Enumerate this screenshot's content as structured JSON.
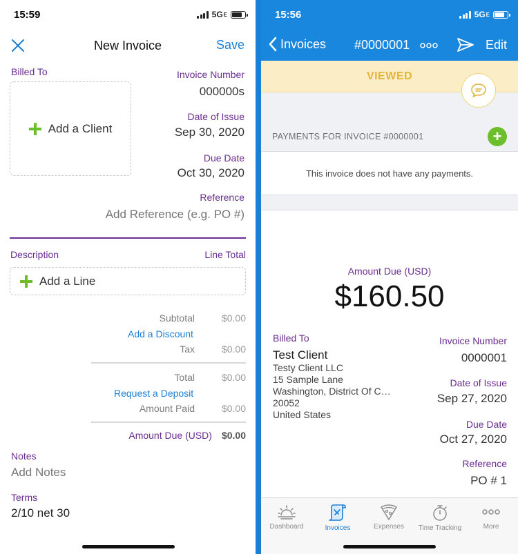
{
  "left": {
    "status": {
      "time": "15:59",
      "network": "5G",
      "network_suffix": "E"
    },
    "nav": {
      "title": "New Invoice",
      "save": "Save"
    },
    "billed_to": {
      "label": "Billed To",
      "add_client": "Add a Client"
    },
    "invoice_number": {
      "label": "Invoice Number",
      "value": "000000s"
    },
    "date_of_issue": {
      "label": "Date of Issue",
      "value": "Sep 30, 2020"
    },
    "due_date": {
      "label": "Due Date",
      "value": "Oct 30, 2020"
    },
    "reference": {
      "label": "Reference",
      "placeholder": "Add Reference (e.g. PO #)"
    },
    "lines": {
      "description_label": "Description",
      "line_total_label": "Line Total",
      "add_line": "Add a Line"
    },
    "totals": {
      "subtotal_label": "Subtotal",
      "subtotal_value": "$0.00",
      "add_discount": "Add a Discount",
      "tax_label": "Tax",
      "tax_value": "$0.00",
      "total_label": "Total",
      "total_value": "$0.00",
      "request_deposit": "Request a Deposit",
      "amount_paid_label": "Amount Paid",
      "amount_paid_value": "$0.00",
      "amount_due_label": "Amount Due (USD)",
      "amount_due_value": "$0.00"
    },
    "notes": {
      "label": "Notes",
      "placeholder": "Add Notes"
    },
    "terms": {
      "label": "Terms",
      "value": "2/10 net 30"
    }
  },
  "right": {
    "status": {
      "time": "15:56",
      "network": "5G",
      "network_suffix": "E"
    },
    "nav": {
      "back": "Invoices",
      "title": "#0000001",
      "edit": "Edit"
    },
    "viewed": "VIEWED",
    "payments_header": "PAYMENTS FOR INVOICE #0000001",
    "no_payments": "This invoice does not have any payments.",
    "amount_due": {
      "label": "Amount Due (USD)",
      "value": "$160.50"
    },
    "billed_to": {
      "label": "Billed To",
      "client_name": "Test Client",
      "address": [
        "Testy Client LLC",
        "15 Sample Lane",
        "Washington, District Of C…",
        "20052",
        "United States"
      ]
    },
    "invoice_number": {
      "label": "Invoice Number",
      "value": "0000001"
    },
    "date_of_issue": {
      "label": "Date of Issue",
      "value": "Sep 27, 2020"
    },
    "due_date": {
      "label": "Due Date",
      "value": "Oct 27, 2020"
    },
    "reference": {
      "label": "Reference",
      "value": "PO # 1"
    },
    "tabs": [
      {
        "label": "Dashboard",
        "icon": "sunrise-icon"
      },
      {
        "label": "Invoices",
        "icon": "invoice-scroll-icon",
        "active": true
      },
      {
        "label": "Expenses",
        "icon": "pizza-icon"
      },
      {
        "label": "Time Tracking",
        "icon": "stopwatch-icon"
      },
      {
        "label": "More",
        "icon": "more-dots-icon"
      }
    ]
  },
  "colors": {
    "accent_blue": "#1a87de",
    "purple": "#6a2c91",
    "green": "#6cbf2a",
    "viewed_yellow": "#e3b43a"
  }
}
